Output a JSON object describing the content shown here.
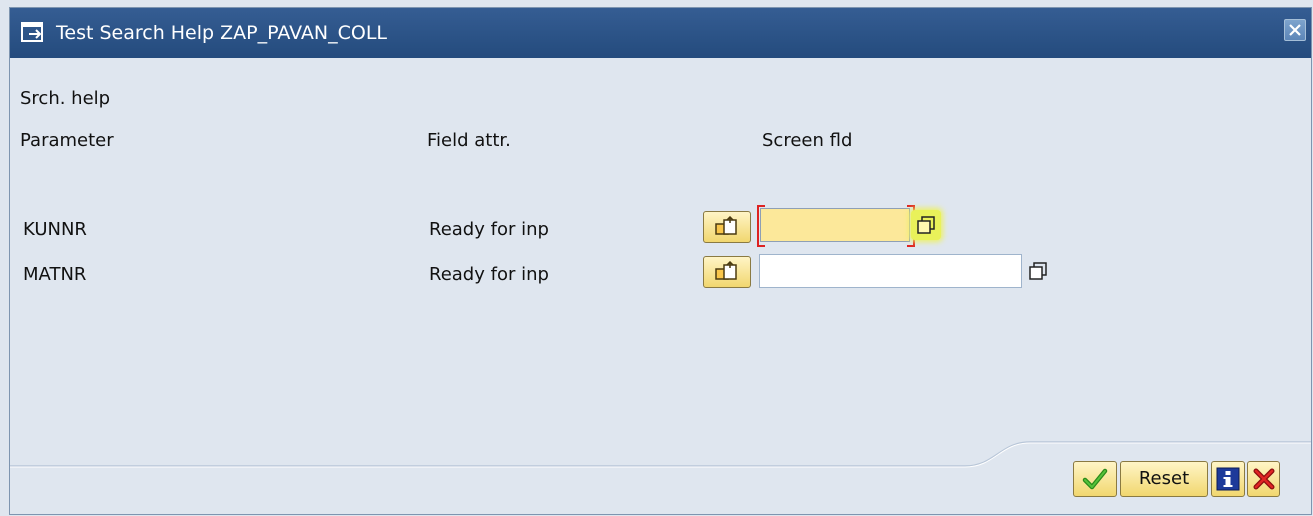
{
  "window": {
    "title": "Test Search Help ZAP_PAVAN_COLL",
    "title_icon": "execute-icon",
    "close_icon": "close-icon"
  },
  "header": {
    "search_help_label": "Srch. help",
    "column_parameter": "Parameter",
    "column_field_attr": "Field attr.",
    "column_screen_field": "Screen fld"
  },
  "rows": [
    {
      "parameter": "KUNNR",
      "field_attr": "Ready for inp",
      "value": "",
      "focused": true
    },
    {
      "parameter": "MATNR",
      "field_attr": "Ready for inp",
      "value": "",
      "focused": false
    }
  ],
  "footer": {
    "ok_icon": "checkmark-icon",
    "reset_label": "Reset",
    "info_icon": "info-icon",
    "cancel_icon": "cancel-icon"
  },
  "colors": {
    "titlebar": "#2d5388",
    "background": "#dfe6ef",
    "focused_input": "#fce89a",
    "button": "#f1d76f",
    "highlight": "#e9f15a"
  }
}
